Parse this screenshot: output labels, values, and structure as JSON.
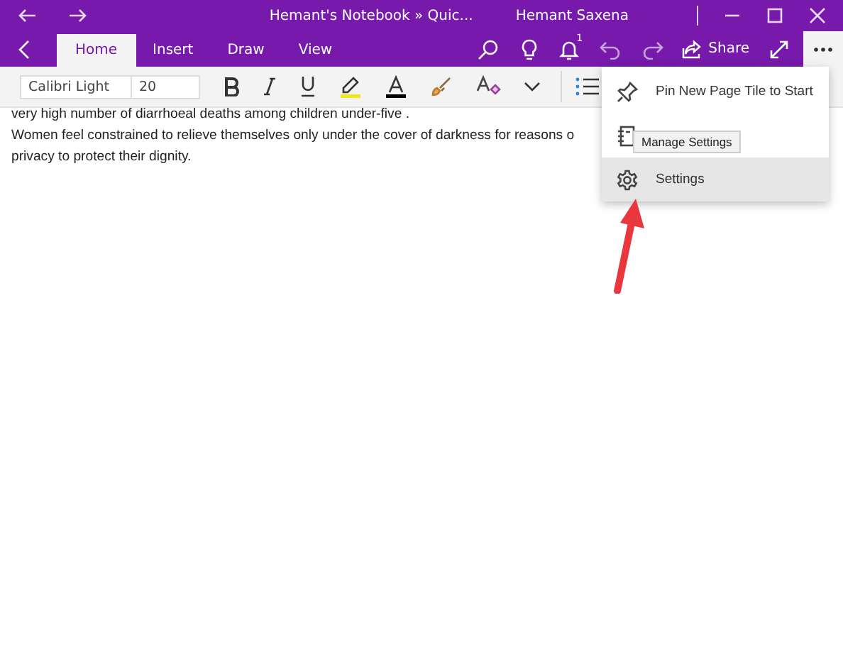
{
  "window": {
    "title": "Hemant's Notebook » Quic...",
    "user": "Hemant Saxena"
  },
  "tabs": [
    {
      "label": "Home",
      "selected": true
    },
    {
      "label": "Insert",
      "selected": false
    },
    {
      "label": "Draw",
      "selected": false
    },
    {
      "label": "View",
      "selected": false
    }
  ],
  "notification_count": "1",
  "share_label": "Share",
  "more_menu_open": true,
  "ribbon": {
    "font": "Calibri Light",
    "size": "20"
  },
  "page_lines": [
    "very high number of diarrhoeal deaths among children under-five .",
    "Women feel constrained to relieve themselves only under the cover of darkness for reasons o",
    "privacy to protect their dignity."
  ],
  "menu": [
    {
      "kind": "pin",
      "label": "Pin New Page Tile to Start",
      "selected": false
    },
    {
      "kind": "print",
      "selected": false
    },
    {
      "kind": "settings",
      "label": "Settings",
      "selected": true
    }
  ],
  "tooltip": "Manage Settings"
}
